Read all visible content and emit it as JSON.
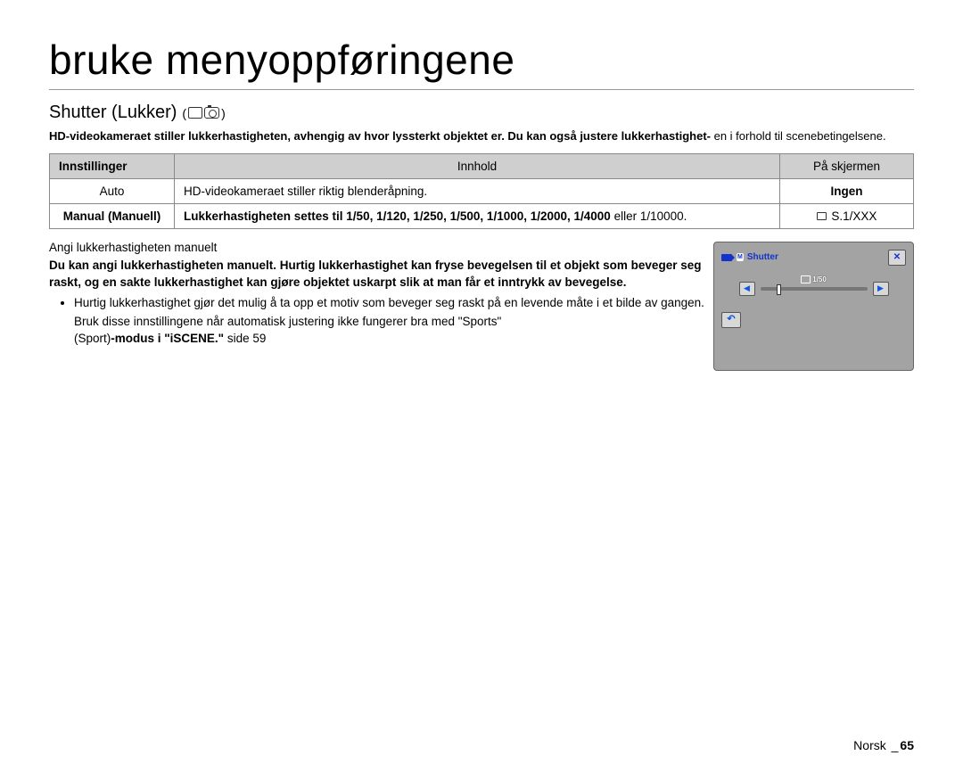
{
  "title": "bruke menyoppføringene",
  "subtitle": "Shutter (Lukker)",
  "subtitle_paren_open": "(",
  "subtitle_paren_close": ")",
  "intro_bold": "HD-videokameraet stiller lukkerhastigheten, avhengig av hvor lyssterkt objektet er. Du kan også justere lukkerhastighet-",
  "intro_rest": "en i forhold til scenebetingelsene.",
  "table": {
    "headers": {
      "c1": "Innstillinger",
      "c2": "Innhold",
      "c3": "På skjermen"
    },
    "rows": [
      {
        "setting": "Auto",
        "content": "HD-videokameraet stiller riktig blenderåpning.",
        "display": "Ingen",
        "setting_bold": false,
        "content_bold": false,
        "display_bold": true
      },
      {
        "setting": "Manual (Manuell)",
        "content": "Lukkerhastigheten settes til 1/50, 1/120, 1/250, 1/500, 1/1000, 1/2000, 1/4000 ",
        "content_suffix": "eller 1/10000.",
        "display": " S.1/XXX",
        "setting_bold": true,
        "content_bold": true,
        "display_bold": false
      }
    ]
  },
  "manualHeader": "Angi lukkerhastigheten manuelt",
  "manualBold": "Du kan angi lukkerhastigheten manuelt. Hurtig lukkerhastighet kan fryse bevegelsen til et objekt som beveger seg raskt, og en sakte lukkerhastighet kan gjøre objektet uskarpt slik at man får et inntrykk av bevegelse.",
  "bullets": [
    "Hurtig lukkerhastighet gjør det mulig å ta opp et motiv som beveger seg raskt på en levende måte i et bilde av gangen."
  ],
  "bullet_sub1": "Bruk disse innstillingene når automatisk justering ikke fungerer bra med \"Sports\"",
  "bullet_sub2_a": "(Sport)",
  "bullet_sub2_b": "-modus i \"iSCENE.\" ",
  "bullet_sub2_c": "side 59",
  "widget": {
    "title": "Shutter",
    "value": "1/50"
  },
  "footer": {
    "lang": "Norsk",
    "sep": "_",
    "page": "65"
  }
}
